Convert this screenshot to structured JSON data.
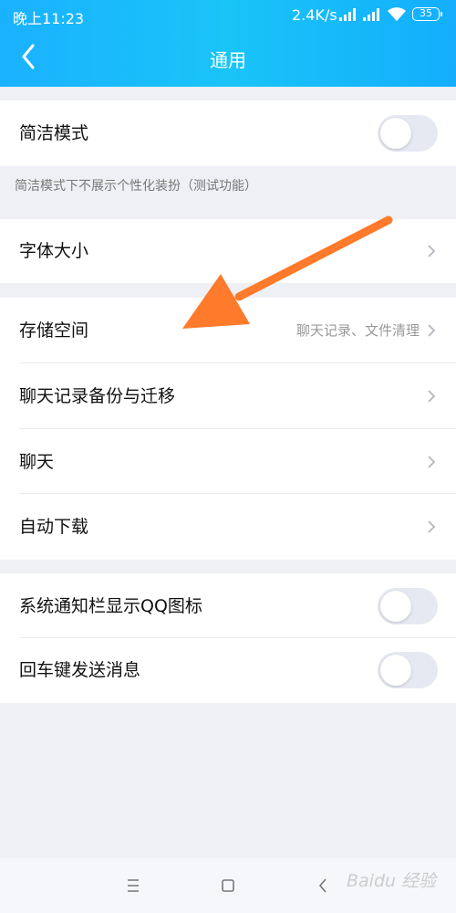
{
  "status_bar": {
    "time": "晚上11:23",
    "speed": "2.4K/s",
    "battery": "35"
  },
  "header": {
    "title": "通用",
    "back_icon": "chevron-left-icon"
  },
  "simple_mode": {
    "label": "简洁模式",
    "toggle_on": false,
    "hint": "简洁模式下不展示个性化装扮（测试功能）"
  },
  "font_size": {
    "label": "字体大小"
  },
  "storage_group": {
    "items": [
      {
        "label": "存储空间",
        "value": "聊天记录、文件清理"
      },
      {
        "label": "聊天记录备份与迁移"
      },
      {
        "label": "聊天"
      },
      {
        "label": "自动下载"
      }
    ]
  },
  "toggles_group": {
    "items": [
      {
        "label": "系统通知栏显示QQ图标",
        "toggle_on": false
      },
      {
        "label": "回车键发送消息",
        "toggle_on": false
      }
    ]
  },
  "nav_bar": {
    "buttons": [
      "menu-icon",
      "home-square-icon",
      "back-triangle-icon"
    ]
  },
  "watermark": "Baidu 经验",
  "colors": {
    "header_gradient_start": "#1ab2ff",
    "header_gradient_end": "#14aefd",
    "arrow": "#ff7a2b",
    "toggle_off": "#e6e9f2",
    "background": "#eff0f5"
  }
}
